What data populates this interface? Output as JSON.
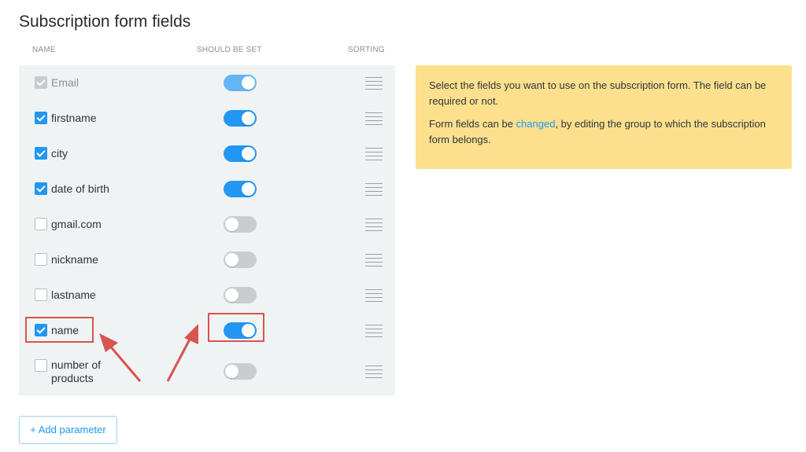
{
  "page": {
    "title": "Subscription form fields"
  },
  "table": {
    "headers": {
      "name": "NAME",
      "should_be_set": "SHOULD BE SET",
      "sorting": "SORTING"
    },
    "rows": [
      {
        "label": "Email",
        "checked": true,
        "disabled": true,
        "toggle": "on-disabled"
      },
      {
        "label": "firstname",
        "checked": true,
        "disabled": false,
        "toggle": "on"
      },
      {
        "label": "city",
        "checked": true,
        "disabled": false,
        "toggle": "on"
      },
      {
        "label": "date of birth",
        "checked": true,
        "disabled": false,
        "toggle": "on"
      },
      {
        "label": "gmail.com",
        "checked": false,
        "disabled": false,
        "toggle": "off"
      },
      {
        "label": "nickname",
        "checked": false,
        "disabled": false,
        "toggle": "off"
      },
      {
        "label": "lastname",
        "checked": false,
        "disabled": false,
        "toggle": "off"
      },
      {
        "label": "name",
        "checked": true,
        "disabled": false,
        "toggle": "on"
      },
      {
        "label": "number of products",
        "checked": false,
        "disabled": false,
        "toggle": "off"
      }
    ]
  },
  "info": {
    "line1": "Select the fields you want to use on the subscription form. The field can be required or not.",
    "line2_before": "Form fields can be ",
    "line2_link": "changed",
    "line2_after": ", by editing the group to which the subscription form belongs."
  },
  "add_button": {
    "label": "+ Add parameter"
  },
  "colors": {
    "accent": "#2196f3",
    "info_bg": "#fce08e",
    "highlight": "#d9534f",
    "table_bg": "#f0f3f4"
  },
  "icons": {
    "drag": "drag-handle-icon",
    "check": "checkmark-icon",
    "arrow": "arrow-annotation"
  }
}
